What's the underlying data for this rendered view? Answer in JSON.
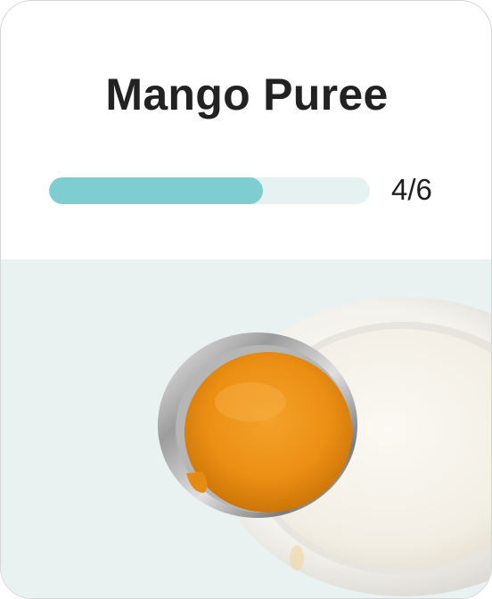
{
  "card": {
    "title": "Mango Puree",
    "progress": {
      "current": 4,
      "total": 6,
      "label": "4/6",
      "fill_color": "#7ecdd0",
      "track_color": "#e6f1f2"
    },
    "image": {
      "icon": "mango-puree-photo",
      "background_color": "#e9f1f1"
    }
  }
}
